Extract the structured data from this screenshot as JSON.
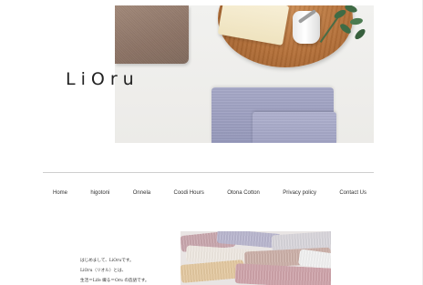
{
  "brand": {
    "logo_text": "LiOru"
  },
  "nav": {
    "items": [
      {
        "label": "Home"
      },
      {
        "label": "higotoni"
      },
      {
        "label": "Onnela"
      },
      {
        "label": "Coodi Hours"
      },
      {
        "label": "Otona Cotton"
      },
      {
        "label": "Privacy policy"
      },
      {
        "label": "Contact Us"
      }
    ]
  },
  "intro": {
    "lines": [
      "はじめまして、LiOruです。",
      "LiOru（リオル）とは、",
      "生活＝Life 織る＝Oru の造語です。"
    ]
  },
  "images": {
    "hero": "towels-cutting-board-photo",
    "secondary": "colorful-towels-stack-photo"
  },
  "colors": {
    "text": "#222222",
    "divider": "#cfcfcf",
    "background": "#ffffff"
  }
}
